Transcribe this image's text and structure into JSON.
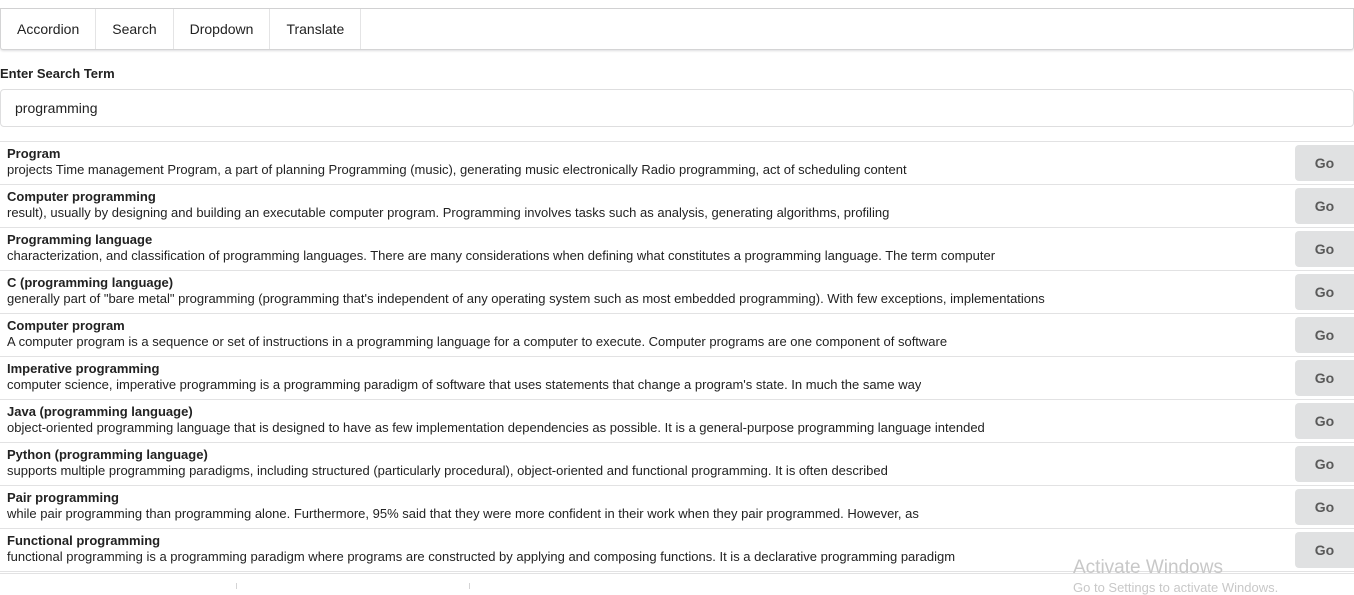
{
  "nav": {
    "items": [
      {
        "label": "Accordion"
      },
      {
        "label": "Search"
      },
      {
        "label": "Dropdown"
      },
      {
        "label": "Translate"
      }
    ]
  },
  "search": {
    "label": "Enter Search Term",
    "value": "programming"
  },
  "results": [
    {
      "title": "Program",
      "snippet": "projects Time management Program, a part of planning Programming (music), generating music electronically Radio programming, act of scheduling content",
      "button_label": "Go"
    },
    {
      "title": "Computer programming",
      "snippet": "result), usually by designing and building an executable computer program. Programming involves tasks such as analysis, generating algorithms, profiling",
      "button_label": "Go"
    },
    {
      "title": "Programming language",
      "snippet": "characterization, and classification of programming languages. There are many considerations when defining what constitutes a programming language. The term computer",
      "button_label": "Go"
    },
    {
      "title": "C (programming language)",
      "snippet": "generally part of \"bare metal\" programming (programming that's independent of any operating system such as most embedded programming). With few exceptions, implementations",
      "button_label": "Go"
    },
    {
      "title": "Computer program",
      "snippet": "A computer program is a sequence or set of instructions in a programming language for a computer to execute. Computer programs are one component of software",
      "button_label": "Go"
    },
    {
      "title": "Imperative programming",
      "snippet": "computer science, imperative programming is a programming paradigm of software that uses statements that change a program's state. In much the same way",
      "button_label": "Go"
    },
    {
      "title": "Java (programming language)",
      "snippet": "object-oriented programming language that is designed to have as few implementation dependencies as possible. It is a general-purpose programming language intended",
      "button_label": "Go"
    },
    {
      "title": "Python (programming language)",
      "snippet": "supports multiple programming paradigms, including structured (particularly procedural), object-oriented and functional programming. It is often described",
      "button_label": "Go"
    },
    {
      "title": "Pair programming",
      "snippet": "while pair programming than programming alone. Furthermore, 95% said that they were more confident in their work when they pair programmed. However, as",
      "button_label": "Go"
    },
    {
      "title": "Functional programming",
      "snippet": "functional programming is a programming paradigm where programs are constructed by applying and composing functions. It is a declarative programming paradigm",
      "button_label": "Go"
    }
  ],
  "watermark": {
    "title": "Activate Windows",
    "subtitle": "Go to Settings to activate Windows."
  }
}
